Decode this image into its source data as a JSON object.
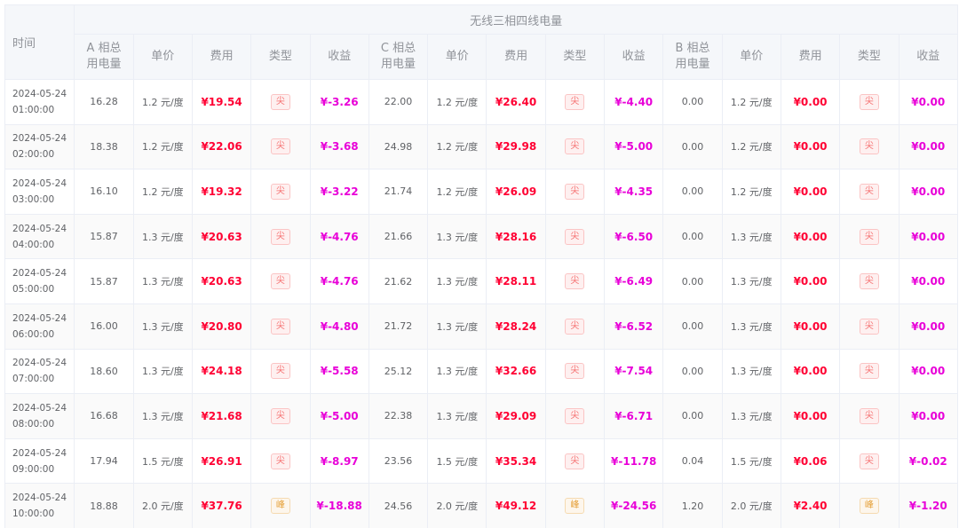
{
  "table": {
    "time_header": "时间",
    "group_title": "无线三相四线电量",
    "phase_a_header": "A 相总\n用电量",
    "phase_c_header": "C 相总\n用电量",
    "phase_b_header": "B 相总\n用电量",
    "price_header": "单价",
    "cost_header": "费用",
    "type_header": "类型",
    "income_header": "收益",
    "rows": [
      {
        "time": "2024-05-24 01:00:00",
        "a": {
          "usage": "16.28",
          "price": "1.2 元/度",
          "cost": "¥19.54",
          "type": "尖",
          "kind": "sharp",
          "income": "¥-3.26"
        },
        "c": {
          "usage": "22.00",
          "price": "1.2 元/度",
          "cost": "¥26.40",
          "type": "尖",
          "kind": "sharp",
          "income": "¥-4.40"
        },
        "b": {
          "usage": "0.00",
          "price": "1.2 元/度",
          "cost": "¥0.00",
          "type": "尖",
          "kind": "sharp",
          "income": "¥0.00"
        }
      },
      {
        "time": "2024-05-24 02:00:00",
        "a": {
          "usage": "18.38",
          "price": "1.2 元/度",
          "cost": "¥22.06",
          "type": "尖",
          "kind": "sharp",
          "income": "¥-3.68"
        },
        "c": {
          "usage": "24.98",
          "price": "1.2 元/度",
          "cost": "¥29.98",
          "type": "尖",
          "kind": "sharp",
          "income": "¥-5.00"
        },
        "b": {
          "usage": "0.00",
          "price": "1.2 元/度",
          "cost": "¥0.00",
          "type": "尖",
          "kind": "sharp",
          "income": "¥0.00"
        }
      },
      {
        "time": "2024-05-24 03:00:00",
        "a": {
          "usage": "16.10",
          "price": "1.2 元/度",
          "cost": "¥19.32",
          "type": "尖",
          "kind": "sharp",
          "income": "¥-3.22"
        },
        "c": {
          "usage": "21.74",
          "price": "1.2 元/度",
          "cost": "¥26.09",
          "type": "尖",
          "kind": "sharp",
          "income": "¥-4.35"
        },
        "b": {
          "usage": "0.00",
          "price": "1.2 元/度",
          "cost": "¥0.00",
          "type": "尖",
          "kind": "sharp",
          "income": "¥0.00"
        }
      },
      {
        "time": "2024-05-24 04:00:00",
        "a": {
          "usage": "15.87",
          "price": "1.3 元/度",
          "cost": "¥20.63",
          "type": "尖",
          "kind": "sharp",
          "income": "¥-4.76"
        },
        "c": {
          "usage": "21.66",
          "price": "1.3 元/度",
          "cost": "¥28.16",
          "type": "尖",
          "kind": "sharp",
          "income": "¥-6.50"
        },
        "b": {
          "usage": "0.00",
          "price": "1.3 元/度",
          "cost": "¥0.00",
          "type": "尖",
          "kind": "sharp",
          "income": "¥0.00"
        }
      },
      {
        "time": "2024-05-24 05:00:00",
        "a": {
          "usage": "15.87",
          "price": "1.3 元/度",
          "cost": "¥20.63",
          "type": "尖",
          "kind": "sharp",
          "income": "¥-4.76"
        },
        "c": {
          "usage": "21.62",
          "price": "1.3 元/度",
          "cost": "¥28.11",
          "type": "尖",
          "kind": "sharp",
          "income": "¥-6.49"
        },
        "b": {
          "usage": "0.00",
          "price": "1.3 元/度",
          "cost": "¥0.00",
          "type": "尖",
          "kind": "sharp",
          "income": "¥0.00"
        }
      },
      {
        "time": "2024-05-24 06:00:00",
        "a": {
          "usage": "16.00",
          "price": "1.3 元/度",
          "cost": "¥20.80",
          "type": "尖",
          "kind": "sharp",
          "income": "¥-4.80"
        },
        "c": {
          "usage": "21.72",
          "price": "1.3 元/度",
          "cost": "¥28.24",
          "type": "尖",
          "kind": "sharp",
          "income": "¥-6.52"
        },
        "b": {
          "usage": "0.00",
          "price": "1.3 元/度",
          "cost": "¥0.00",
          "type": "尖",
          "kind": "sharp",
          "income": "¥0.00"
        }
      },
      {
        "time": "2024-05-24 07:00:00",
        "a": {
          "usage": "18.60",
          "price": "1.3 元/度",
          "cost": "¥24.18",
          "type": "尖",
          "kind": "sharp",
          "income": "¥-5.58"
        },
        "c": {
          "usage": "25.12",
          "price": "1.3 元/度",
          "cost": "¥32.66",
          "type": "尖",
          "kind": "sharp",
          "income": "¥-7.54"
        },
        "b": {
          "usage": "0.00",
          "price": "1.3 元/度",
          "cost": "¥0.00",
          "type": "尖",
          "kind": "sharp",
          "income": "¥0.00"
        }
      },
      {
        "time": "2024-05-24 08:00:00",
        "a": {
          "usage": "16.68",
          "price": "1.3 元/度",
          "cost": "¥21.68",
          "type": "尖",
          "kind": "sharp",
          "income": "¥-5.00"
        },
        "c": {
          "usage": "22.38",
          "price": "1.3 元/度",
          "cost": "¥29.09",
          "type": "尖",
          "kind": "sharp",
          "income": "¥-6.71"
        },
        "b": {
          "usage": "0.00",
          "price": "1.3 元/度",
          "cost": "¥0.00",
          "type": "尖",
          "kind": "sharp",
          "income": "¥0.00"
        }
      },
      {
        "time": "2024-05-24 09:00:00",
        "a": {
          "usage": "17.94",
          "price": "1.5 元/度",
          "cost": "¥26.91",
          "type": "尖",
          "kind": "sharp",
          "income": "¥-8.97"
        },
        "c": {
          "usage": "23.56",
          "price": "1.5 元/度",
          "cost": "¥35.34",
          "type": "尖",
          "kind": "sharp",
          "income": "¥-11.78"
        },
        "b": {
          "usage": "0.04",
          "price": "1.5 元/度",
          "cost": "¥0.06",
          "type": "尖",
          "kind": "sharp",
          "income": "¥-0.02"
        }
      },
      {
        "time": "2024-05-24 10:00:00",
        "a": {
          "usage": "18.88",
          "price": "2.0 元/度",
          "cost": "¥37.76",
          "type": "峰",
          "kind": "peak",
          "income": "¥-18.88"
        },
        "c": {
          "usage": "24.56",
          "price": "2.0 元/度",
          "cost": "¥49.12",
          "type": "峰",
          "kind": "peak",
          "income": "¥-24.56"
        },
        "b": {
          "usage": "1.20",
          "price": "2.0 元/度",
          "cost": "¥2.40",
          "type": "峰",
          "kind": "peak",
          "income": "¥-1.20"
        }
      }
    ]
  }
}
